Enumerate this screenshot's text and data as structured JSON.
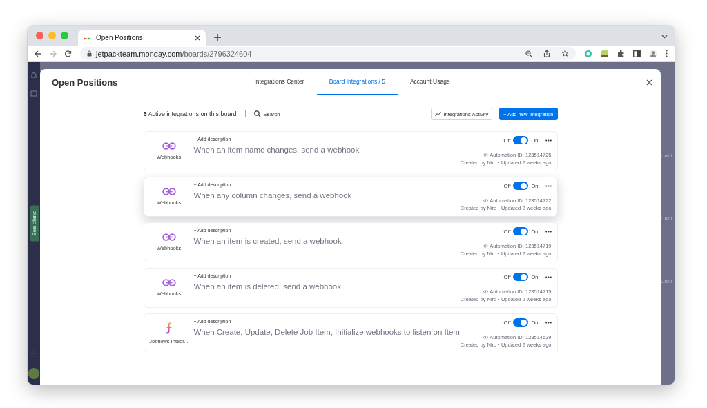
{
  "browser": {
    "tab_title": "Open Positions",
    "url_host": "jetpackteam.monday.com",
    "url_path": "/boards/2796324604"
  },
  "sidebar": {
    "promo": "See plans"
  },
  "modal": {
    "title": "Open Positions",
    "tabs": [
      {
        "label": "Integrations Center",
        "selected": false
      },
      {
        "label": "Board Integrations / 5",
        "selected": true
      },
      {
        "label": "Account Usage",
        "selected": false
      }
    ]
  },
  "toolbar": {
    "summary": "**5** Active integrations on this board",
    "search": "Search",
    "activity_button": "Integrations Activity",
    "add_button": "+ Add new integration"
  },
  "integrations": [
    {
      "kind": "webhooks",
      "app": "Webhooks",
      "add_description": "+ Add description",
      "title": "When an item name changes, send a webhook",
      "off_label": "Off",
      "on_label": "On",
      "on": true,
      "automation_id": "Automation ID: 123514725",
      "meta": "Created by Niro · Updated 2 weeks ago",
      "highlighted": false
    },
    {
      "kind": "webhooks",
      "app": "Webhooks",
      "add_description": "+ Add description",
      "title": "When any column changes, send a webhook",
      "off_label": "Off",
      "on_label": "On",
      "on": true,
      "automation_id": "Automation ID: 123514722",
      "meta": "Created by Niro · Updated 2 weeks ago",
      "highlighted": true
    },
    {
      "kind": "webhooks",
      "app": "Webhooks",
      "add_description": "+ Add description",
      "title": "When an item is created, send a webhook",
      "off_label": "Off",
      "on_label": "On",
      "on": true,
      "automation_id": "Automation ID: 123514719",
      "meta": "Created by Niro · Updated 2 weeks ago",
      "highlighted": false
    },
    {
      "kind": "webhooks",
      "app": "Webhooks",
      "add_description": "+ Add description",
      "title": "When an item is deleted, send a webhook",
      "off_label": "Off",
      "on_label": "On",
      "on": true,
      "automation_id": "Automation ID: 123514715",
      "meta": "Created by Niro · Updated 2 weeks ago",
      "highlighted": false
    },
    {
      "kind": "jobflows",
      "app": "Jobflows Integr...",
      "add_description": "+ Add description",
      "title": "When Create, Update, Delete Job Item, Initialize webhooks to listen on Item",
      "off_label": "Off",
      "on_label": "On",
      "on": true,
      "automation_id": "Automation ID: 123514639",
      "meta": "Created by Niro · Updated 2 weeks ago",
      "highlighted": false
    }
  ],
  "background_board": {
    "cells": [
      "Link t",
      "Link t",
      "Link t"
    ]
  }
}
